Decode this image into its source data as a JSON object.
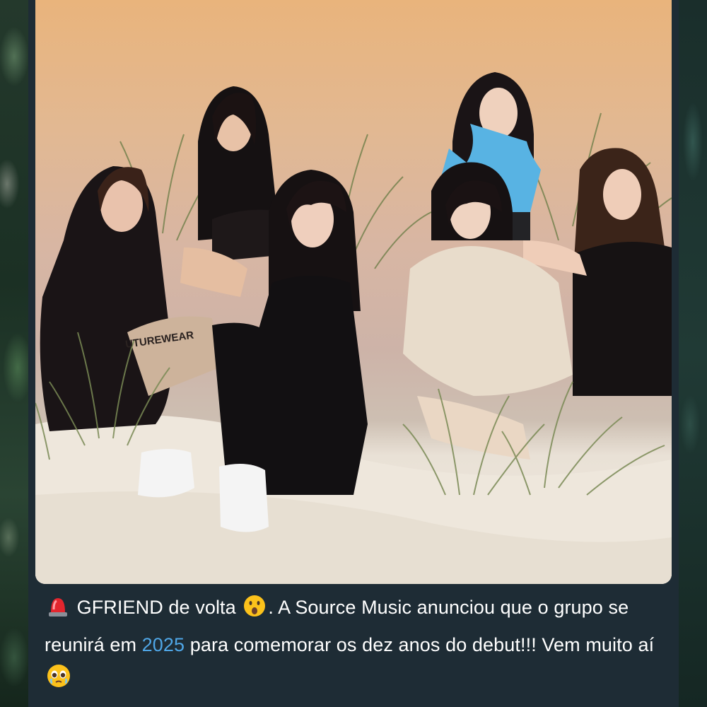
{
  "post": {
    "image_alt": "GFRIEND group photo",
    "caption": {
      "siren_icon": "siren-icon",
      "part1": "GFRIEND de volta",
      "surprised_icon": "surprised-face-icon",
      "part2": ". A Source Music anunciou que o grupo se reunirá em ",
      "highlight": "2025",
      "part3": " para comemorar os dez anos do debut!!!  Vem muito aí",
      "teary_icon": "teary-face-icon"
    },
    "colors": {
      "card_bg": "#1e2c35",
      "text": "#ffffff",
      "highlight": "#4fa6e6"
    }
  },
  "photo_text": {
    "jacket_print": "UTUREWEAR"
  }
}
